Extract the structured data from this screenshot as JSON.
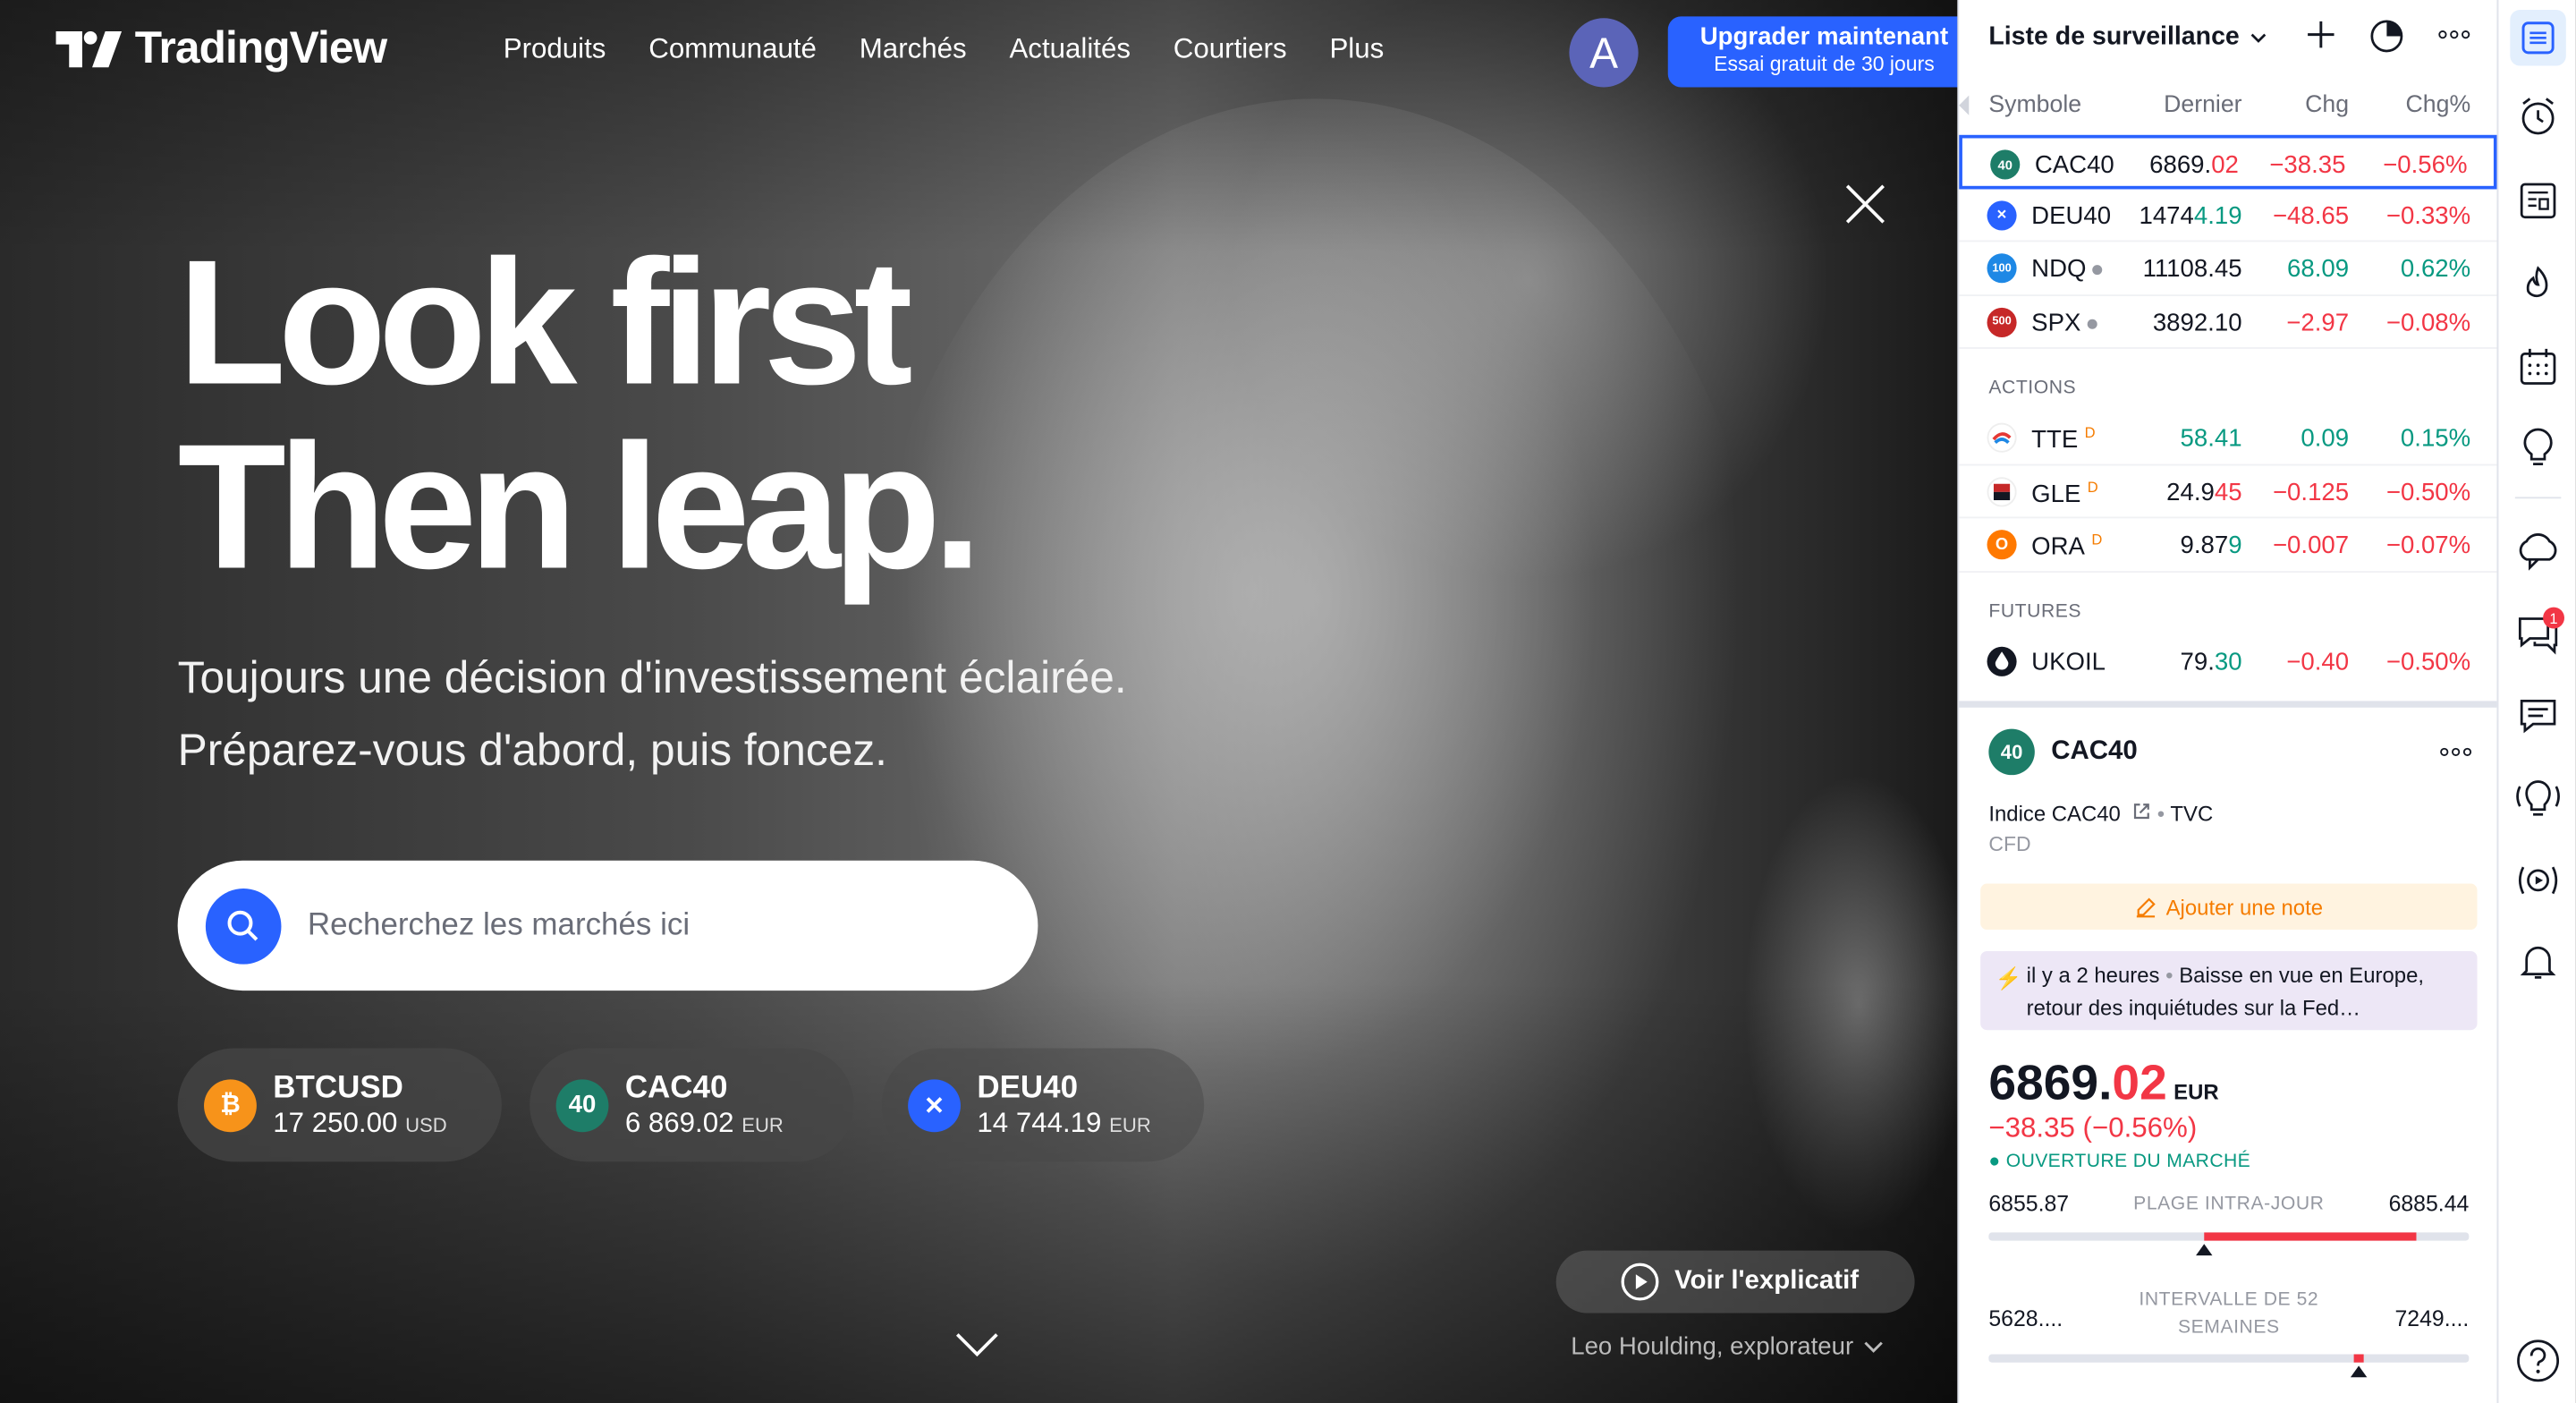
{
  "app": {
    "name": "TradingView"
  },
  "nav": {
    "items": [
      "Produits",
      "Communauté",
      "Marchés",
      "Actualités",
      "Courtiers",
      "Plus"
    ]
  },
  "user": {
    "avatar_letter": "A"
  },
  "upgrade": {
    "title": "Upgrader maintenant",
    "subtitle": "Essai gratuit de 30 jours"
  },
  "hero": {
    "headline_1": "Look first",
    "headline_2": "Then leap.",
    "sub_1": "Toujours une décision d'investissement éclairée.",
    "sub_2": "Préparez-vous d'abord, puis foncez.",
    "search_placeholder": "Recherchez les marchés ici",
    "explain_label": "Voir l'explicatif",
    "credit": "Leo Houlding, explorateur"
  },
  "hero_tickers": [
    {
      "name": "BTCUSD",
      "value": "17 250.00",
      "currency": "USD",
      "icon": "bitcoin-icon",
      "color": "#f7931a",
      "icon_text": "₿"
    },
    {
      "name": "CAC40",
      "value": "6 869.02",
      "currency": "EUR",
      "icon": "cac40-icon",
      "color": "#1e7d68",
      "icon_text": "40"
    },
    {
      "name": "DEU40",
      "value": "14 744.19",
      "currency": "EUR",
      "icon": "deu40-icon",
      "color": "#2962ff",
      "icon_text": "✕"
    }
  ],
  "watchlist": {
    "title": "Liste de surveillance",
    "columns": {
      "symbol": "Symbole",
      "last": "Dernier",
      "chg": "Chg",
      "pct": "Chg%"
    },
    "indices": [
      {
        "symbol": "CAC40",
        "last_a": "6869.",
        "last_b": "02",
        "chg": "−38.35",
        "pct": "−0.56%",
        "dir": "down",
        "icon_text": "40",
        "color": "#1e7d68"
      },
      {
        "symbol": "DEU40",
        "last_a": "1474",
        "last_b": "4.19",
        "chg": "−48.65",
        "pct": "−0.33%",
        "dir": "down",
        "icon_text": "✕",
        "color": "#2962ff"
      },
      {
        "symbol": "NDQ",
        "last_a": "11108.45",
        "last_b": "",
        "chg": "68.09",
        "pct": "0.62%",
        "dir": "up",
        "icon_text": "100",
        "color": "#1e88e5"
      },
      {
        "symbol": "SPX",
        "last_a": "3892.10",
        "last_b": "",
        "chg": "−2.97",
        "pct": "−0.08%",
        "dir": "down",
        "icon_text": "500",
        "color": "#c62828"
      }
    ],
    "section_actions": "ACTIONS",
    "actions": [
      {
        "symbol": "TTE",
        "last_a": "",
        "last_b": "58.41",
        "chg": "0.09",
        "pct": "0.15%",
        "dir": "up",
        "icon_text": "",
        "color": "#e53935"
      },
      {
        "symbol": "GLE",
        "last_a": "24.9",
        "last_b": "45",
        "chg": "−0.125",
        "pct": "−0.50%",
        "dir": "down",
        "icon_text": "",
        "color": "#c62828"
      },
      {
        "symbol": "ORA",
        "last_a": "9.87",
        "last_b": "9",
        "chg": "−0.007",
        "pct": "−0.07%",
        "dir": "down",
        "icon_text": "O",
        "color": "#ff7900"
      }
    ],
    "delay_marker": "D",
    "section_futures": "FUTURES",
    "futures": [
      {
        "symbol": "UKOIL",
        "last_a": "79.",
        "last_b": "30",
        "chg": "−0.40",
        "pct": "−0.50%",
        "dir": "down",
        "icon_text": "",
        "color": "#131722"
      }
    ]
  },
  "detail": {
    "symbol": "CAC40",
    "icon_text": "40",
    "description": "Indice CAC40",
    "source": "TVC",
    "type": "CFD",
    "note_label": "Ajouter une note",
    "news_time": "il y a 2 heures",
    "news_text": "Baisse en vue en Europe,",
    "news_text_2": "retour des inquiétudes sur la Fed…",
    "price_a": "6869.",
    "price_b": "02",
    "currency": "EUR",
    "change": "−38.35 (−0.56%)",
    "market_status": "OUVERTURE DU MARCHÉ",
    "intraday": {
      "label": "PLAGE INTRA-JOUR",
      "low": "6855.87",
      "high": "6885.44",
      "fill_from": 0.45,
      "fill_to": 0.89,
      "marker": 0.45
    },
    "week52": {
      "label_1": "INTERVALLE DE 52",
      "label_2": "SEMAINES",
      "low": "5628....",
      "high": "7249....",
      "marker": 0.77
    }
  },
  "colors": {
    "accent": "#2962ff",
    "up": "#089981",
    "down": "#f23645"
  }
}
